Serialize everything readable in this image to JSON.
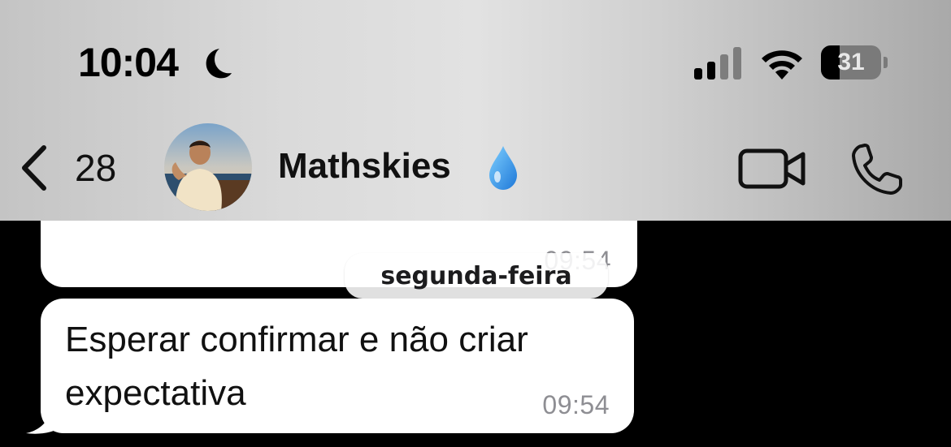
{
  "status_bar": {
    "time": "10:04",
    "focus_icon": "moon-icon",
    "signal_icon": "cellular-signal-icon",
    "wifi_icon": "wifi-icon",
    "battery_level": "31",
    "battery_fraction": 0.31
  },
  "nav": {
    "back_icon": "chevron-left-icon",
    "unread_count": "28",
    "contact_name": "Mathskies",
    "name_emoji": "droplet-icon",
    "video_icon": "video-camera-icon",
    "call_icon": "phone-icon"
  },
  "chat": {
    "previous_message": {
      "partial_text": "",
      "time": "09:54"
    },
    "day_separator": "segunda-feira",
    "messages": [
      {
        "text": "Esperar confirmar e não criar expectativa",
        "time": "09:54"
      }
    ]
  },
  "colors": {
    "bubble": "#ffffff",
    "chat_background": "#000000",
    "timestamp": "#8e8e93",
    "droplet": "#3aa0f0"
  }
}
